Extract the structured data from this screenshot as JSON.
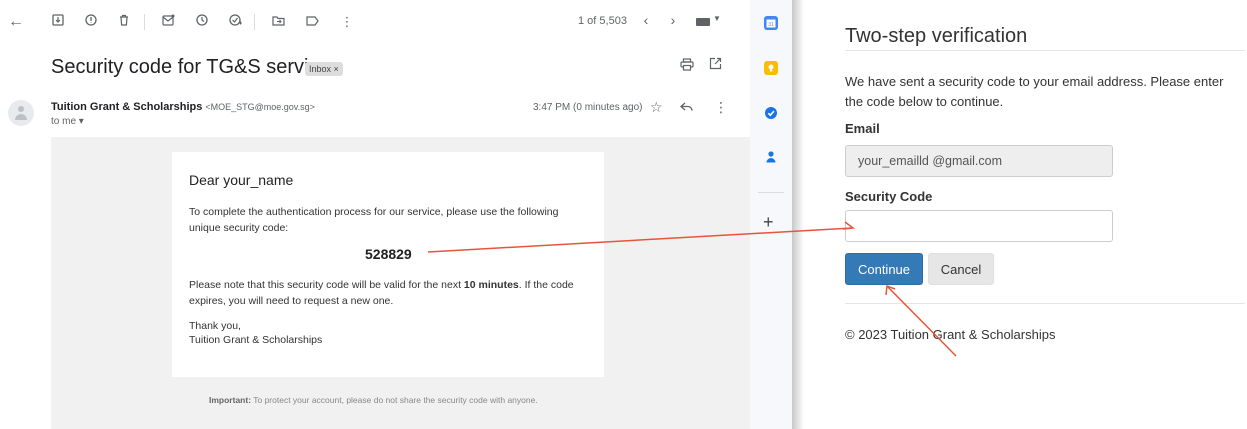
{
  "gmail": {
    "toolbar": {
      "icons": [
        "back-arrow-icon",
        "archive-icon",
        "report-spam-icon",
        "delete-icon",
        "mark-unread-icon",
        "snooze-icon",
        "add-to-tasks-icon",
        "move-to-icon",
        "label-icon",
        "more-vert-icon"
      ],
      "pager": "1 of 5,503"
    },
    "subject": "Security code for TG&S services",
    "label_chip": "Inbox ×",
    "sender": {
      "name": "Tuition Grant & Scholarships",
      "email": "<MOE_STG@moe.gov.sg>",
      "to": "to me ▾",
      "time": "3:47 PM (0 minutes ago)"
    },
    "body": {
      "greeting": "Dear your_name",
      "intro": "To complete the authentication process for our service, please use the following unique security code:",
      "code": "528829",
      "validity_before": "Please note that this security code will be valid for the next ",
      "validity_bold": "10 minutes",
      "validity_after": ". If the code expires, you will need to request a new one.",
      "thanks": "Thank you,",
      "signature": "Tuition Grant & Scholarships",
      "important_label": "Important:",
      "important_text": " To protect your account, please do not share the security code with anyone."
    }
  },
  "side_rail": {
    "icons": [
      "calendar-icon",
      "keep-icon",
      "tasks-icon",
      "contacts-icon",
      "plus-icon"
    ],
    "colors": {
      "calendar": "#1a73e8",
      "keep": "#fbbc04",
      "tasks": "#1a73e8",
      "contacts": "#1a73e8"
    }
  },
  "verify": {
    "title": "Two-step verification",
    "description": "We have sent a security code to your email address. Please enter the code below to continue.",
    "email_label": "Email",
    "email_value": "your_emailld @gmail.com",
    "code_label": "Security Code",
    "code_value": "",
    "continue_label": "Continue",
    "cancel_label": "Cancel",
    "footer": "© 2023 Tuition Grant & Scholarships",
    "accent": "#337ab7"
  },
  "annotation": {
    "arrow_color": "#e8543a"
  }
}
